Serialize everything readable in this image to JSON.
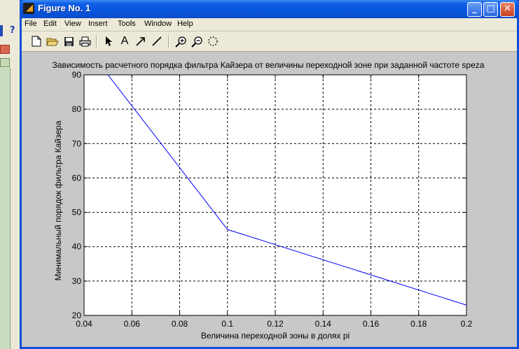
{
  "window": {
    "title": "Figure No. 1",
    "buttons": {
      "minimize": "_",
      "maximize": "□",
      "close": "✕"
    }
  },
  "background_app": {
    "help_glyph": "?"
  },
  "menubar": {
    "items": [
      "File",
      "Edit",
      "View",
      "Insert",
      "Tools",
      "Window",
      "Help"
    ]
  },
  "toolbar": {
    "tools": [
      "new-file-icon",
      "open-folder-icon",
      "save-icon",
      "print-icon",
      "pointer-icon",
      "text-icon",
      "arrow-icon",
      "line-icon",
      "zoom-in-icon",
      "zoom-out-icon",
      "rotate-icon"
    ],
    "text_tool_label": "A"
  },
  "colors": {
    "titlebar": "#0855dd",
    "figure_bg": "#c8c8c8",
    "axes_bg": "#ffffff",
    "line": "#0000ff"
  },
  "chart_data": {
    "type": "line",
    "title": "Зависимость расчетного порядка фильтра Кайзера от величины переходной зоне при заданной частоте speza",
    "xlabel": "Величина переходной зоны в долях pi",
    "ylabel": "Минимальный порядок фильтра Кайзера",
    "xlim": [
      0.04,
      0.2
    ],
    "ylim": [
      20,
      90
    ],
    "xticks": [
      0.04,
      0.06,
      0.08,
      0.1,
      0.12,
      0.14,
      0.16,
      0.18,
      0.2
    ],
    "xtick_labels": [
      "0.04",
      "0.06",
      "0.08",
      "0.1",
      "0.12",
      "0.14",
      "0.16",
      "0.18",
      "0.2"
    ],
    "yticks": [
      20,
      30,
      40,
      50,
      60,
      70,
      80,
      90
    ],
    "ytick_labels": [
      "20",
      "30",
      "40",
      "50",
      "60",
      "70",
      "80",
      "90"
    ],
    "grid": true,
    "series": [
      {
        "x": [
          0.05,
          0.1,
          0.2
        ],
        "y": [
          90,
          45,
          23
        ]
      }
    ]
  }
}
